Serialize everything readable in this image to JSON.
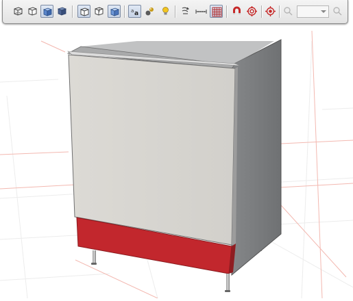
{
  "toolbar": {
    "buttons": [
      {
        "name": "view-iso-wire-button",
        "icon": "cube-wireframe-icon",
        "active": false
      },
      {
        "name": "view-front-outline-button",
        "icon": "cube-outline-icon",
        "active": false
      },
      {
        "name": "view-shaded-button",
        "icon": "cube-shaded-blue-icon",
        "active": true
      },
      {
        "name": "view-solid-button",
        "icon": "cube-solid-blue-icon",
        "active": false
      },
      {
        "name": "render-outline-button",
        "icon": "cube-outline-icon",
        "active": true
      },
      {
        "name": "render-hidden-line-button",
        "icon": "cube-hidden-line-icon",
        "active": false
      },
      {
        "name": "render-shaded-button",
        "icon": "cube-shaded-blue-icon",
        "active": true
      },
      {
        "name": "texture-text-button",
        "icon": "aa-texture-icon",
        "active": true
      },
      {
        "name": "materials-button",
        "icon": "spheres-icon",
        "active": false
      },
      {
        "name": "light-button",
        "icon": "light-bulb-icon",
        "active": false
      },
      {
        "name": "section-button",
        "icon": "section-cut-icon",
        "active": false
      },
      {
        "name": "dimension-button",
        "icon": "dimension-ruler-icon",
        "active": false
      },
      {
        "name": "grid-button",
        "icon": "grid-icon",
        "active": true
      },
      {
        "name": "magnet-snap-button",
        "icon": "magnet-icon",
        "active": false
      },
      {
        "name": "target-snap-button",
        "icon": "target-icon",
        "active": false
      },
      {
        "name": "center-view-button",
        "icon": "crosshair-icon",
        "active": false
      },
      {
        "name": "zoom-out-button",
        "icon": "magnifier-icon",
        "active": false,
        "disabled": true
      },
      {
        "name": "zoom-in-button",
        "icon": "magnifier-icon",
        "active": false,
        "disabled": true
      }
    ],
    "zoom_value": ""
  },
  "scene": {
    "description_colors": {
      "front_panel": "#d9d7d2",
      "side_panel": "#7c7e80",
      "plinth": "#c2272d",
      "grid_major": "#f0b9b3",
      "grid_minor": "#ececec"
    }
  }
}
